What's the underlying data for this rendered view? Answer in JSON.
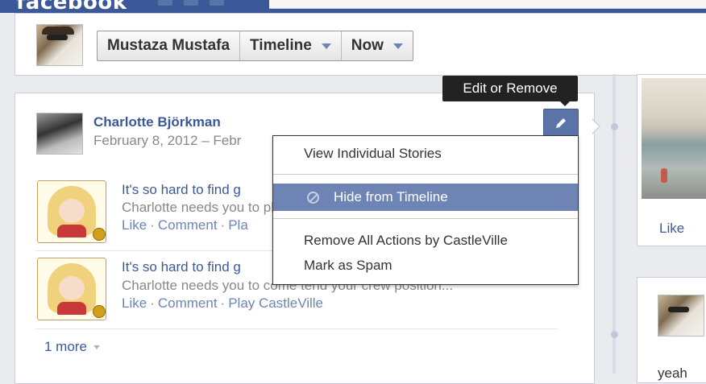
{
  "header": {
    "brand": "facebook",
    "breadcrumb": {
      "name": "Mustaza Mustafa",
      "section": "Timeline",
      "period": "Now"
    }
  },
  "story": {
    "author": "Charlotte Björkman",
    "date_line": "February 8, 2012 – Febr",
    "items": [
      {
        "title": "It's so hard to find g",
        "desc": "Charlotte needs you to pl",
        "action_like": "Like",
        "action_comment": "Comment",
        "action_app": "Pla"
      },
      {
        "title": "It's so hard to find g",
        "desc": "Charlotte needs you to come tend your crew position...",
        "action_like": "Like",
        "action_comment": "Comment",
        "action_app": "Play CastleVille"
      }
    ],
    "separator": "·",
    "more_label": "1 more"
  },
  "tooltip": "Edit or Remove",
  "menu": {
    "items": [
      "View Individual Stories",
      "Hide from Timeline",
      "Remove All Actions by CastleVille",
      "Mark as Spam"
    ],
    "highlighted_index": 1
  },
  "right_column": {
    "like_label": "Like",
    "partial_text": "yeah"
  },
  "colors": {
    "brand_blue": "#3b5998",
    "link_blue": "#3b5998",
    "menu_highlight": "#6d84b4",
    "tooltip_bg": "#222222"
  },
  "icons": [
    "pencil-icon",
    "ban-icon",
    "caret-down-icon"
  ]
}
